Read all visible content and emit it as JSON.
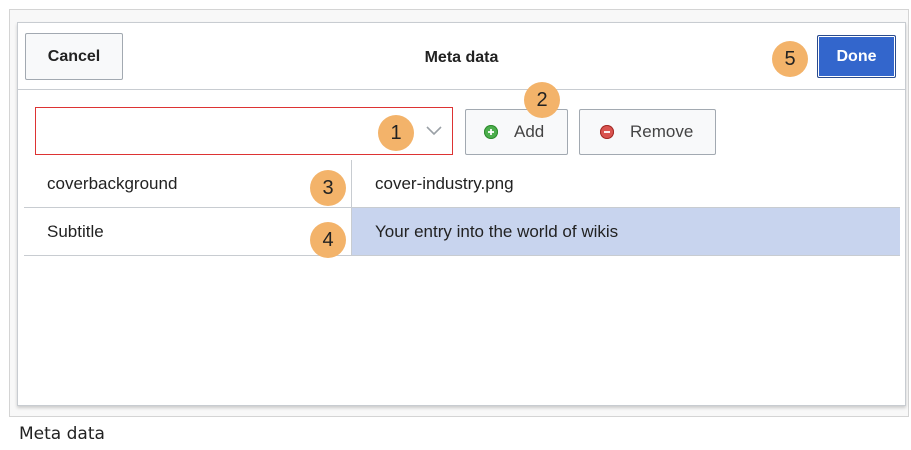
{
  "dialog": {
    "title": "Meta data",
    "cancel_label": "Cancel",
    "done_label": "Done"
  },
  "toolbar": {
    "combo_value": "",
    "combo_placeholder": "",
    "add_label": "Add",
    "remove_label": "Remove"
  },
  "table": {
    "rows": [
      {
        "key": "coverbackground",
        "value": "cover-industry.png",
        "selected": false
      },
      {
        "key": "Subtitle",
        "value": "Your entry into the world of wikis",
        "selected": true
      }
    ]
  },
  "annotations": [
    "1",
    "2",
    "3",
    "4",
    "5"
  ],
  "caption": "Meta data",
  "colors": {
    "accent": "#3366cc",
    "badge": "#f3b36a",
    "selected_row": "#c8d4ee",
    "error_border": "#dd3333",
    "add_icon": "#4cae4c",
    "remove_icon": "#d9534f"
  }
}
